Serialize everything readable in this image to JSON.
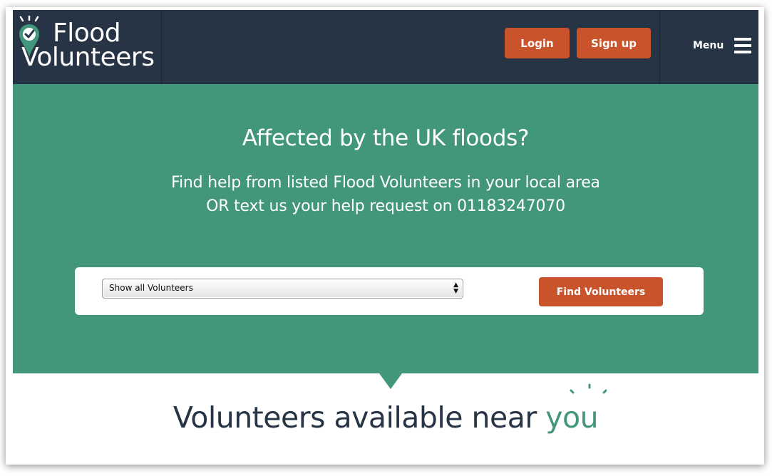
{
  "brand": {
    "name_line1": "Flood",
    "name_line2": "Volunteers",
    "logo_icon": "map-pin-check-icon",
    "colors": {
      "header": "#263445",
      "accent": "#41967c",
      "button": "#c9532a"
    }
  },
  "header": {
    "login_label": "Login",
    "signup_label": "Sign up",
    "menu_label": "Menu",
    "menu_icon": "hamburger-icon"
  },
  "hero": {
    "title": "Affected by the UK floods?",
    "subtitle_line1": "Find help from listed Flood Volunteers in your local area",
    "subtitle_line2": "OR text us your help request on 01183247070"
  },
  "search": {
    "select_value": "Show all Volunteers",
    "find_button_label": "Find Volunteers"
  },
  "section": {
    "title_prefix": "Volunteers available near ",
    "title_accent": "you"
  }
}
